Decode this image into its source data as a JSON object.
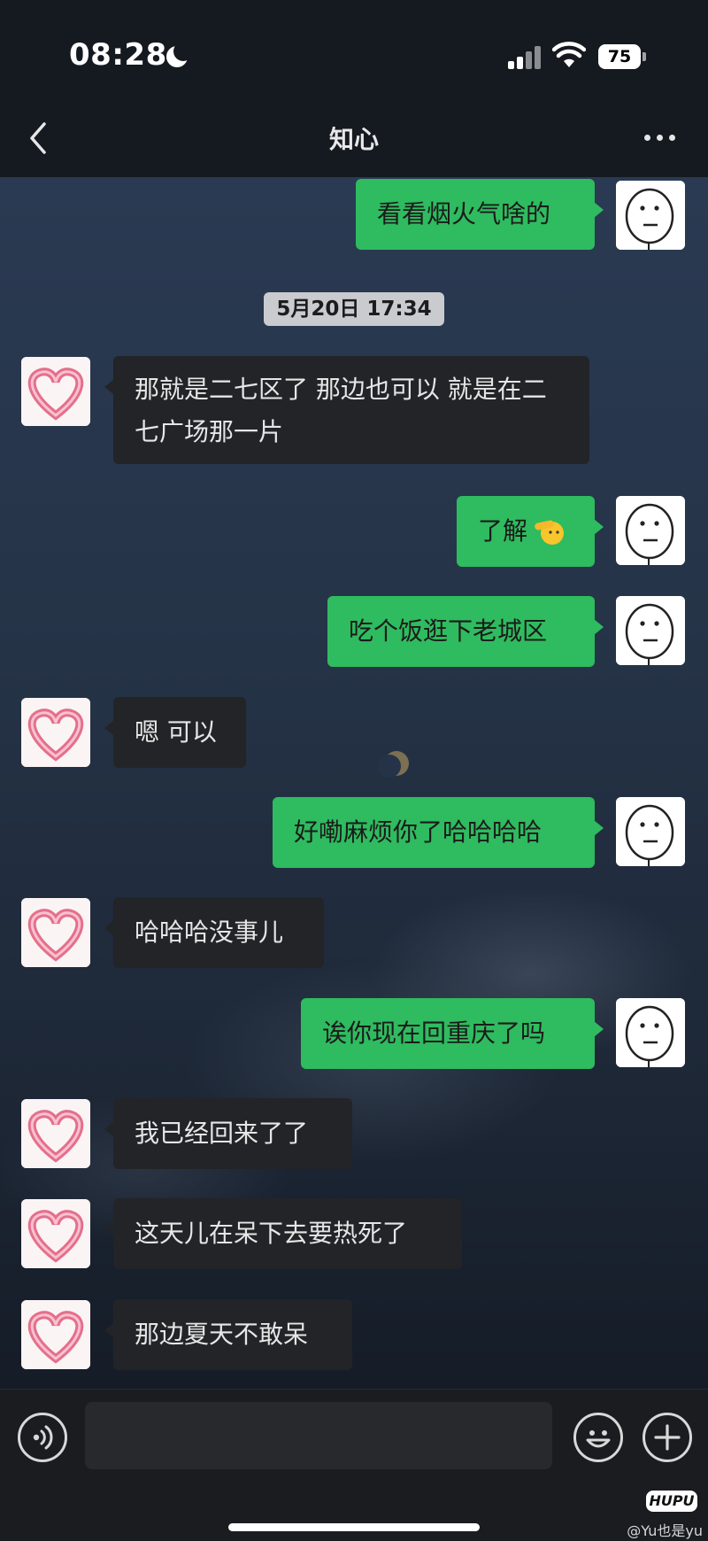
{
  "status_bar": {
    "time": "08:28",
    "focus_icon": "moon-icon",
    "battery": "75"
  },
  "header": {
    "title": "知心",
    "back_icon": "chevron-left-icon",
    "more_icon": "more-dots-icon"
  },
  "messages": [
    {
      "from": "me",
      "text": "看看烟火气啥的",
      "avatar": "meme-face-avatar"
    },
    {
      "type": "timestamp",
      "text": "5月20日 17:34"
    },
    {
      "from": "them",
      "text": "那就是二七区了 那边也可以 就是在二七广场那一片",
      "avatar": "heart-avatar"
    },
    {
      "from": "me",
      "text": "了解",
      "emoji": "saluting-face-emoji",
      "avatar": "meme-face-avatar"
    },
    {
      "from": "me",
      "text": "吃个饭逛下老城区",
      "avatar": "meme-face-avatar"
    },
    {
      "from": "them",
      "text": "嗯 可以",
      "avatar": "heart-avatar"
    },
    {
      "from": "me",
      "text": "好嘞麻烦你了哈哈哈哈",
      "avatar": "meme-face-avatar"
    },
    {
      "from": "them",
      "text": "哈哈哈没事儿",
      "avatar": "heart-avatar"
    },
    {
      "from": "me",
      "text": "诶你现在回重庆了吗",
      "avatar": "meme-face-avatar"
    },
    {
      "from": "them",
      "text": "我已经回来了了",
      "avatar": "heart-avatar"
    },
    {
      "from": "them",
      "text": "这天儿在呆下去要热死了",
      "avatar": "heart-avatar"
    },
    {
      "from": "them",
      "text": "那边夏天不敢呆",
      "avatar": "heart-avatar"
    }
  ],
  "input_bar": {
    "voice_icon": "voice-icon",
    "message_value": "",
    "emoji_icon": "emoji-icon",
    "plus_icon": "plus-icon"
  },
  "watermark": {
    "logo": "HUPU",
    "text": "@Yu也是yu"
  },
  "colors": {
    "my_bubble": "#2fbb5f",
    "their_bubble": "#232427",
    "header_bg": "#151a20"
  }
}
